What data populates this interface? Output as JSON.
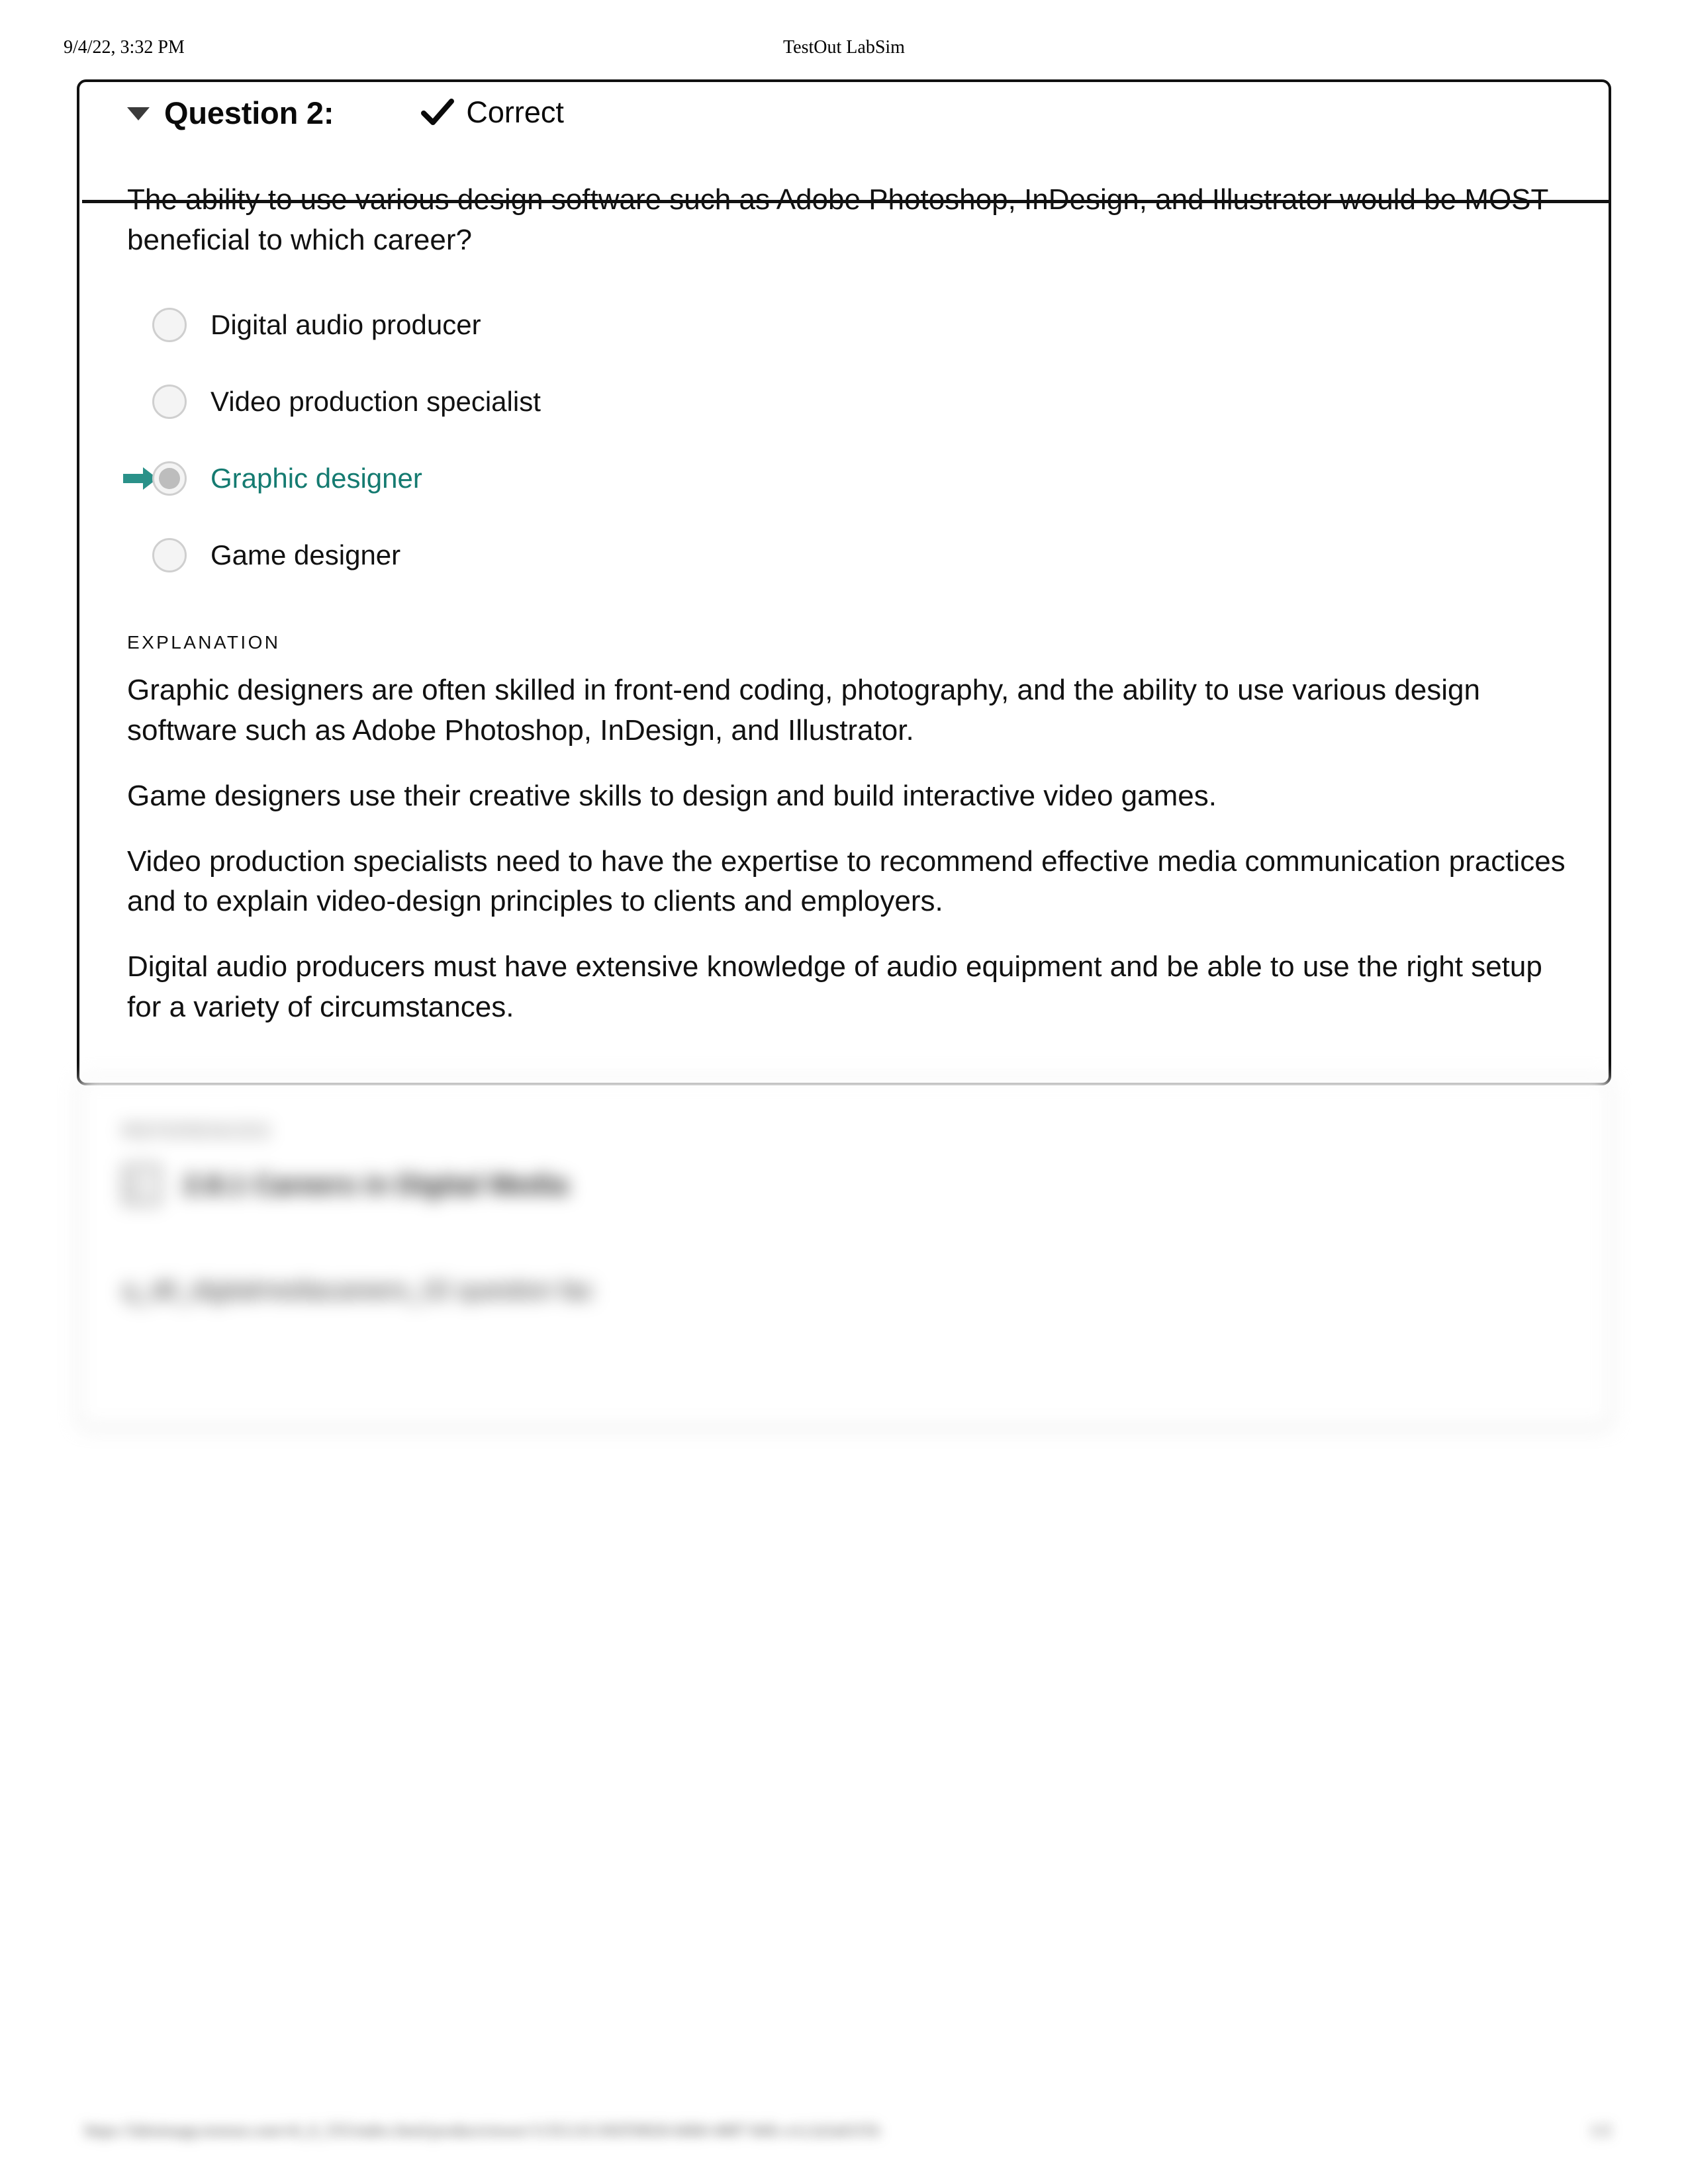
{
  "print_header": {
    "date": "9/4/22, 3:32 PM",
    "title": "TestOut LabSim"
  },
  "question_card": {
    "collapse_icon": "triangle-down-icon",
    "question_label": "Question 2:",
    "verdict_icon": "checkmark-icon",
    "verdict_text": "Correct",
    "question_text": "The ability to use various design software such as Adobe Photoshop, InDesign, and Illustrator would be MOST beneficial to which career?",
    "options": [
      {
        "label": "Digital audio producer",
        "selected": false,
        "is_answer": false
      },
      {
        "label": "Video production specialist",
        "selected": false,
        "is_answer": false
      },
      {
        "label": "Graphic designer",
        "selected": true,
        "is_answer": true
      },
      {
        "label": "Game designer",
        "selected": false,
        "is_answer": false
      }
    ],
    "answer_arrow_icon": "arrow-right-icon",
    "explanation_heading": "EXPLANATION",
    "explanation_paragraphs": [
      "Graphic designers are often skilled in front-end coding, photography, and the ability to use various design software such as Adobe Photoshop, InDesign, and Illustrator.",
      "Game designers use their creative skills to design and build interactive video games.",
      "Video production specialists need to have the expertise to recommend effective media communication practices and to explain video-design principles to clients and employers.",
      "Digital audio producers must have extensive knowledge of audio equipment and be able to use the right setup for a variety of circumstances."
    ]
  },
  "references_panel": {
    "heading": "REFERENCES",
    "book_icon": "book-icon",
    "reference_label": "2.8.1 Careers in Digital Media",
    "question_code": "q_dtl_digitalmediacareers_02 question fac"
  },
  "print_footer": {
    "url": "https://labsimapp.testout.com/v6_0_555/index.html/productviewer/1135/2.8.5/82f59026-b6b0-4087-b6fc-e1c2a5a61f1b",
    "page": "1/2"
  },
  "colors": {
    "correct_answer": "#157b71",
    "arrow": "#2a9189",
    "card_border": "#111111",
    "radio_fill": "#bdbdbd"
  }
}
